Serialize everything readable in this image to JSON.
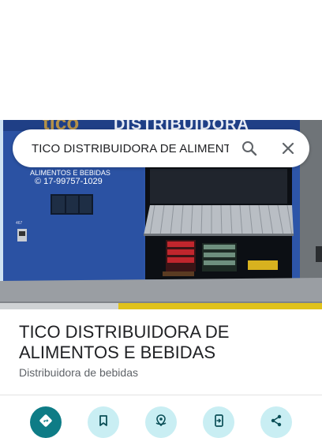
{
  "search": {
    "query": "TICO DISTRIBUIDORA DE ALIMENTOS E BEBIDAS"
  },
  "photo": {
    "sign_text": "DISTRIBUIDORA",
    "wall_lines": [
      "ALIMENTOS E BEBIDAS",
      "© 17-99757-1029"
    ]
  },
  "place": {
    "name": "TICO DISTRIBUIDORA DE ALIMENTOS E BEBIDAS",
    "category": "Distribuidora de bebidas"
  },
  "actions": [
    {
      "icon": "directions-icon"
    },
    {
      "icon": "save-icon"
    },
    {
      "icon": "nearby-icon"
    },
    {
      "icon": "send-to-phone-icon"
    },
    {
      "icon": "share-icon"
    }
  ],
  "colors": {
    "accent": "#0e7c86",
    "action_bg": "#c9eef3",
    "wall": "#2d55a8"
  }
}
